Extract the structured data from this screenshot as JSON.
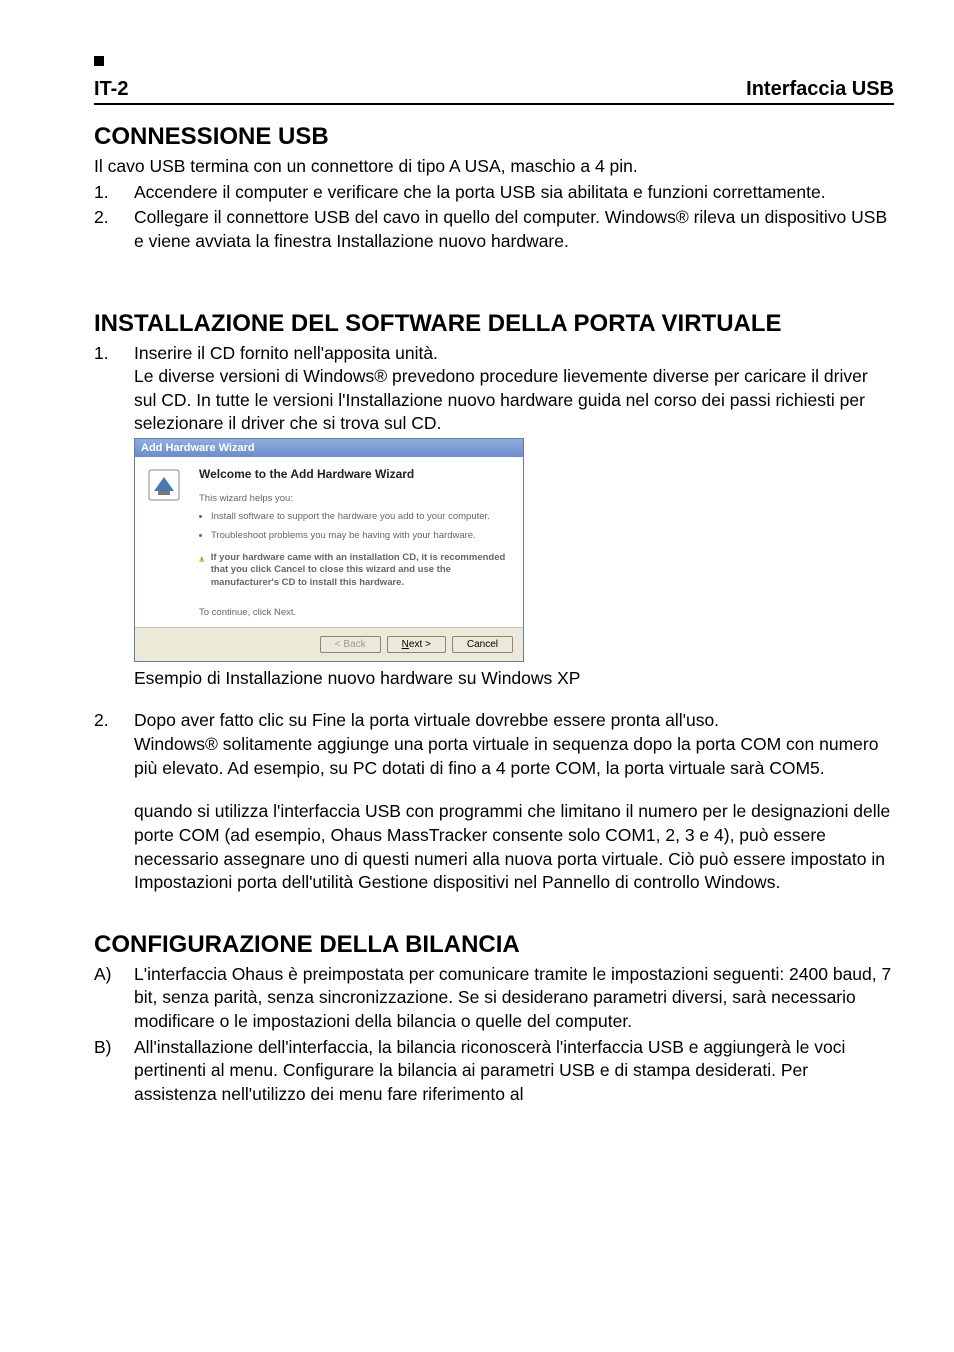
{
  "header": {
    "left": "IT-2",
    "right": "Interfaccia USB"
  },
  "section1": {
    "title": "CONNESSIONE USB",
    "intro": "Il cavo USB termina con un connettore di tipo A USA, maschio a 4 pin.",
    "items": [
      {
        "marker": "1.",
        "text": "Accendere il computer e verificare che la porta USB sia abilitata e funzioni correttamente."
      },
      {
        "marker": "2.",
        "text": "Collegare il connettore USB del cavo in quello del computer. Windows® rileva un dispositivo USB e viene avviata la finestra Installazione nuovo hardware."
      }
    ]
  },
  "section2": {
    "title": "INSTALLAZIONE DEL SOFTWARE DELLA PORTA VIRTUALE",
    "item1_marker": "1.",
    "item1_text": "Inserire il CD fornito nell'apposita unità.",
    "item1_cont": "Le diverse versioni di Windows® prevedono procedure lievemente diverse per caricare il driver sul CD. In tutte le versioni l'Installazione nuovo hardware guida nel corso dei passi richiesti per selezionare il driver che si trova sul CD.",
    "wizard": {
      "titlebar": "Add Hardware Wizard",
      "heading": "Welcome to the Add Hardware Wizard",
      "helps": "This wizard helps you:",
      "bullet1": "Install software to support the hardware you add to your computer.",
      "bullet2": "Troubleshoot problems you may be having with your hardware.",
      "warn": "If your hardware came with an installation CD, it is recommended that you click Cancel to close this wizard and use the manufacturer's CD to install this hardware.",
      "cont": "To continue, click Next.",
      "back": "< Back",
      "next": "Next >",
      "cancel": "Cancel"
    },
    "caption": "Esempio di Installazione nuovo hardware su Windows XP",
    "item2_marker": "2.",
    "item2_text": "Dopo aver fatto clic su Fine la porta virtuale dovrebbe essere pronta all'uso.",
    "item2_cont": "Windows® solitamente aggiunge una porta virtuale in sequenza dopo la porta COM con numero più elevato. Ad esempio, su PC dotati di fino a 4 porte COM, la porta virtuale sarà COM5.",
    "note": "quando si utilizza l'interfaccia USB con programmi che limitano il numero per le designazioni delle porte COM (ad esempio, Ohaus MassTracker consente solo COM1, 2, 3 e 4), può essere necessario assegnare uno di questi numeri alla nuova porta virtuale. Ciò può essere impostato in Impostazioni porta dell'utilità Gestione dispositivi nel Pannello di controllo Windows."
  },
  "section3": {
    "title": "CONFIGURAZIONE DELLA BILANCIA",
    "items": [
      {
        "marker": "A)",
        "text": "L'interfaccia Ohaus è preimpostata per comunicare tramite le impostazioni seguenti: 2400 baud, 7 bit, senza parità, senza sincronizzazione. Se si desiderano parametri diversi, sarà necessario modificare o le impostazioni della bilancia o quelle del computer."
      },
      {
        "marker": "B)",
        "text": "All'installazione dell'interfaccia, la bilancia riconoscerà l'interfaccia USB e aggiungerà le voci pertinenti al menu. Configurare la bilancia ai parametri USB e di stampa desiderati. Per assistenza nell'utilizzo dei menu fare riferimento al"
      }
    ]
  }
}
